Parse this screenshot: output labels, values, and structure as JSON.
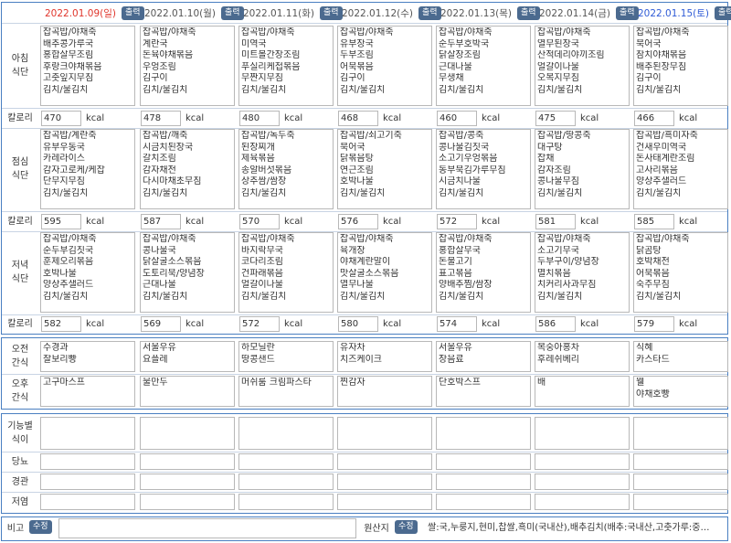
{
  "days": [
    {
      "date": "2022.01.09(일)",
      "date_color": "#e0352b",
      "breakfast": [
        "잡곡밥/야채죽",
        "배추콩가루국",
        "홍합살무조림",
        "후랑크야채볶음",
        "고춧잎지무침",
        "김치/물김치"
      ],
      "breakfast_kcal": "470",
      "lunch": [
        "잡곡밥/계란죽",
        "유부우동국",
        "카레라이스",
        "감자고로케/케찹",
        "단무지무침",
        "김치/물김치"
      ],
      "lunch_kcal": "595",
      "dinner": [
        "잡곡밥/야채죽",
        "순두부김칫국",
        "훈제오리볶음",
        "호박나물",
        "양상추샐러드",
        "김치/물김치"
      ],
      "dinner_kcal": "582",
      "am_snack": [
        "수경과",
        "찰보리빵"
      ],
      "pm_snack": [
        "고구마스프"
      ]
    },
    {
      "date": "2022.01.10(월)",
      "date_color": "#555555",
      "breakfast": [
        "잡곡밥/야채죽",
        "계란국",
        "돈육야채볶음",
        "우엉조림",
        "김구이",
        "김치/물김치"
      ],
      "breakfast_kcal": "478",
      "lunch": [
        "잡곡밥/깨죽",
        "시금치된장국",
        "갈치조림",
        "감자채전",
        "다시마채초무침",
        "김치/물김치"
      ],
      "lunch_kcal": "587",
      "dinner": [
        "잡곡밥/야채죽",
        "콩나물국",
        "닭살굴소스볶음",
        "도토리묵/양념장",
        "근대나물",
        "김치/물김치"
      ],
      "dinner_kcal": "569",
      "am_snack": [
        "서울우유",
        "요플레"
      ],
      "pm_snack": [
        "물만두"
      ]
    },
    {
      "date": "2022.01.11(화)",
      "date_color": "#555555",
      "breakfast": [
        "잡곡밥/야채죽",
        "미역국",
        "미트볼간장조림",
        "푸실리케첩볶음",
        "무짠지무침",
        "김치/물김치"
      ],
      "breakfast_kcal": "480",
      "lunch": [
        "잡곡밥/녹두죽",
        "된장찌개",
        "제육볶음",
        "송알버섯볶음",
        "상추쌈/쌈장",
        "김치/물김치"
      ],
      "lunch_kcal": "570",
      "dinner": [
        "잡곡밥/야채죽",
        "바지락무국",
        "코다리조림",
        "건파래볶음",
        "얼갈이나물",
        "김치/물김치"
      ],
      "dinner_kcal": "572",
      "am_snack": [
        "하모닐란",
        "땅콩샌드"
      ],
      "pm_snack": [
        "머쉬룸 크림파스타"
      ]
    },
    {
      "date": "2022.01.12(수)",
      "date_color": "#555555",
      "breakfast": [
        "잡곡밥/야채죽",
        "유부장국",
        "두부조림",
        "어묵볶음",
        "김구이",
        "김치/물김치"
      ],
      "breakfast_kcal": "468",
      "lunch": [
        "잡곡밥/쇠고기죽",
        "북어국",
        "닭볶음탕",
        "연근조림",
        "호박나물",
        "김치/물김치"
      ],
      "lunch_kcal": "576",
      "dinner": [
        "잡곡밥/야채죽",
        "육개장",
        "야채계란말이",
        "맛살굴소스볶음",
        "열무나물",
        "김치/물김치"
      ],
      "dinner_kcal": "580",
      "am_snack": [
        "유자차",
        "치즈케이크"
      ],
      "pm_snack": [
        "찐감자"
      ]
    },
    {
      "date": "2022.01.13(목)",
      "date_color": "#555555",
      "breakfast": [
        "잡곡밥/야채죽",
        "순두부호박국",
        "닭살장조림",
        "근대나물",
        "무생채",
        "김치/물김치"
      ],
      "breakfast_kcal": "460",
      "lunch": [
        "잡곡밥/콩죽",
        "콩나물김칫국",
        "소고기우엉볶음",
        "동부묵김가루무침",
        "시금치나물",
        "김치/물김치"
      ],
      "lunch_kcal": "572",
      "dinner": [
        "잡곡밥/야채죽",
        "홍합살무국",
        "돈불고기",
        "표고볶음",
        "양배추찜/쌈장",
        "김치/물김치"
      ],
      "dinner_kcal": "574",
      "am_snack": [
        "서울우유",
        "장음료"
      ],
      "pm_snack": [
        "단호박스프"
      ]
    },
    {
      "date": "2022.01.14(금)",
      "date_color": "#555555",
      "breakfast": [
        "잡곡밥/야채죽",
        "열무된장국",
        "산적데리야끼조림",
        "얼갈이나물",
        "오복지무침",
        "김치/물김치"
      ],
      "breakfast_kcal": "475",
      "lunch": [
        "잡곡밥/땅콩죽",
        "대구탕",
        "잡채",
        "감자조림",
        "콩나물무침",
        "김치/물김치"
      ],
      "lunch_kcal": "581",
      "dinner": [
        "잡곡밥/야채죽",
        "소고기무국",
        "두부구이/양념장",
        "멸치볶음",
        "치커리사과무침",
        "김치/물김치"
      ],
      "dinner_kcal": "586",
      "am_snack": [
        "복숭아홍차",
        "후레쉬베리"
      ],
      "pm_snack": [
        "배"
      ]
    },
    {
      "date": "2022.01.15(토)",
      "date_color": "#2f5bd6",
      "breakfast": [
        "잡곡밥/야채죽",
        "북어국",
        "참치야채볶음",
        "배추된장무침",
        "김구이",
        "김치/물김치"
      ],
      "breakfast_kcal": "466",
      "lunch": [
        "잡곡밥/흑미자죽",
        "건새우미역국",
        "돈사태계란조림",
        "고사리볶음",
        "양상추샐러드",
        "김치/물김치"
      ],
      "lunch_kcal": "585",
      "dinner": [
        "잡곡밥/야채죽",
        "닭곰탕",
        "호박채전",
        "어묵볶음",
        "숙주무침",
        "김치/물김치"
      ],
      "dinner_kcal": "579",
      "am_snack": [
        "식혜",
        "카스타드"
      ],
      "pm_snack": [
        "웰",
        "야채호빵"
      ]
    }
  ],
  "labels": {
    "breakfast": "아침\n식단",
    "lunch": "점심\n식단",
    "dinner": "저녁\n식단",
    "calorie": "칼로리",
    "kcal": "kcal",
    "am_snack": "오전\n간식",
    "pm_snack": "오후\n간식",
    "functional": "기능별\n식이",
    "diabetes": "당뇨",
    "tube": "경관",
    "low_salt": "저염",
    "print": "출력",
    "remarks": "비고",
    "edit": "수정",
    "origin": "원산지"
  },
  "origin_text": "쌀:국,누룽지,현미,찹쌀,흑미(국내산),배추김치(배추:국내산,고춧가루:중…",
  "colors": {
    "border": "#4a7fc1",
    "button": "#4b6a8f",
    "sunday": "#e0352b",
    "saturday": "#2f5bd6"
  }
}
